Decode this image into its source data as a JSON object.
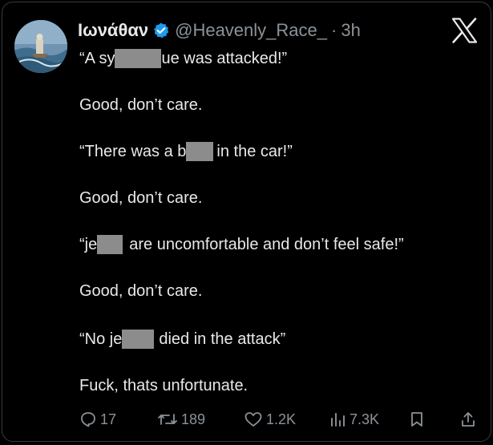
{
  "tweet": {
    "author": {
      "display_name": "Ιωνάθαν",
      "handle": "@Heavenly_Race_",
      "verified": true
    },
    "separator": "·",
    "time": "3h",
    "lines": {
      "l1_a": "“A sy",
      "l1_b": "ue was attacked!”",
      "l2": "Good, don’t care.",
      "l3_a": "“There was a b",
      "l3_b": "in the car!”",
      "l4": "Good, don’t care.",
      "l5_a": "“je",
      "l5_b": "are uncomfortable and don’t feel safe!”",
      "l6": "Good, don’t care.",
      "l7_a": "“No je",
      "l7_b": "died in the attack”",
      "l8": "Fuck, thats unfortunate."
    },
    "stats": {
      "replies": "17",
      "reposts": "189",
      "likes": "1.2K",
      "views": "7.3K"
    }
  },
  "icons": {
    "platform_logo": "x-logo",
    "verified_badge": "verified-badge-icon",
    "reply": "reply-icon",
    "repost": "repost-icon",
    "like": "heart-icon",
    "views": "views-icon",
    "bookmark": "bookmark-icon",
    "share": "share-icon"
  },
  "colors": {
    "background": "#000000",
    "text": "#e7e9ea",
    "muted": "#8b9298",
    "verified": "#1d9bf0",
    "redaction": "#8c8c8c"
  }
}
